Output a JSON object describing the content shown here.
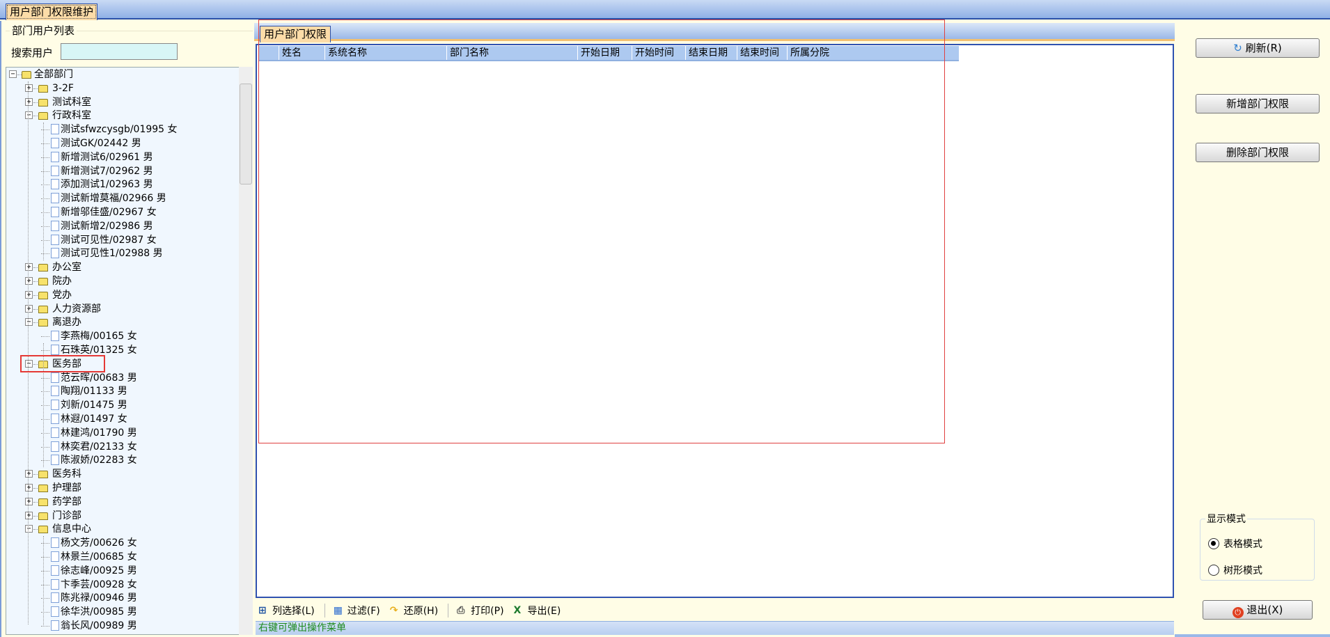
{
  "window_tab": "用户部门权限维护",
  "left_panel": {
    "group_title": "部门用户列表",
    "search_label": "搜索用户",
    "search_value": "",
    "tree": [
      {
        "label": "全部部门",
        "level": 0,
        "type": "folder",
        "expanded": true
      },
      {
        "label": "3-2F",
        "level": 1,
        "type": "folder",
        "expanded": false
      },
      {
        "label": "测试科室",
        "level": 1,
        "type": "folder",
        "expanded": false
      },
      {
        "label": "行政科室",
        "level": 1,
        "type": "folder",
        "expanded": true
      },
      {
        "label": "测试sfwzcysgb/01995 女",
        "level": 2,
        "type": "user"
      },
      {
        "label": "测试GK/02442 男",
        "level": 2,
        "type": "user"
      },
      {
        "label": "新增测试6/02961 男",
        "level": 2,
        "type": "user"
      },
      {
        "label": "新增测试7/02962 男",
        "level": 2,
        "type": "user"
      },
      {
        "label": "添加测试1/02963 男",
        "level": 2,
        "type": "user"
      },
      {
        "label": "测试新增莫福/02966 男",
        "level": 2,
        "type": "user"
      },
      {
        "label": "新增邬佳盛/02967 女",
        "level": 2,
        "type": "user"
      },
      {
        "label": "测试新增2/02986 男",
        "level": 2,
        "type": "user"
      },
      {
        "label": "测试可见性/02987 女",
        "level": 2,
        "type": "user"
      },
      {
        "label": "测试可见性1/02988 男",
        "level": 2,
        "type": "user"
      },
      {
        "label": "办公室",
        "level": 1,
        "type": "folder",
        "expanded": false
      },
      {
        "label": "院办",
        "level": 1,
        "type": "folder",
        "expanded": false
      },
      {
        "label": "党办",
        "level": 1,
        "type": "folder",
        "expanded": false
      },
      {
        "label": "人力资源部",
        "level": 1,
        "type": "folder",
        "expanded": false
      },
      {
        "label": "离退办",
        "level": 1,
        "type": "folder",
        "expanded": true
      },
      {
        "label": "李燕梅/00165 女",
        "level": 2,
        "type": "user"
      },
      {
        "label": "石珠英/01325 女",
        "level": 2,
        "type": "user"
      },
      {
        "label": "医务部",
        "level": 1,
        "type": "folder",
        "expanded": true,
        "selected": true
      },
      {
        "label": "范云晖/00683 男",
        "level": 2,
        "type": "user"
      },
      {
        "label": "陶翔/01133 男",
        "level": 2,
        "type": "user"
      },
      {
        "label": "刘新/01475 男",
        "level": 2,
        "type": "user"
      },
      {
        "label": "林遐/01497 女",
        "level": 2,
        "type": "user"
      },
      {
        "label": "林建鸿/01790 男",
        "level": 2,
        "type": "user"
      },
      {
        "label": "林奕君/02133 女",
        "level": 2,
        "type": "user"
      },
      {
        "label": "陈淑娇/02283 女",
        "level": 2,
        "type": "user"
      },
      {
        "label": "医务科",
        "level": 1,
        "type": "folder",
        "expanded": false
      },
      {
        "label": "护理部",
        "level": 1,
        "type": "folder",
        "expanded": false
      },
      {
        "label": "药学部",
        "level": 1,
        "type": "folder",
        "expanded": false
      },
      {
        "label": "门诊部",
        "level": 1,
        "type": "folder",
        "expanded": false
      },
      {
        "label": "信息中心",
        "level": 1,
        "type": "folder",
        "expanded": true
      },
      {
        "label": "杨文芳/00626 女",
        "level": 2,
        "type": "user"
      },
      {
        "label": "林景兰/00685 女",
        "level": 2,
        "type": "user"
      },
      {
        "label": "徐志峰/00925 男",
        "level": 2,
        "type": "user"
      },
      {
        "label": "卞季芸/00928 女",
        "level": 2,
        "type": "user"
      },
      {
        "label": "陈兆禄/00946 男",
        "level": 2,
        "type": "user"
      },
      {
        "label": "徐华洪/00985 男",
        "level": 2,
        "type": "user"
      },
      {
        "label": "翁长风/00989 男",
        "level": 2,
        "type": "user"
      }
    ]
  },
  "center": {
    "tab": "用户部门权限",
    "columns": [
      "",
      "姓名",
      "系统名称",
      "部门名称",
      "开始日期",
      "开始时间",
      "结束日期",
      "结束时间",
      "所属分院"
    ],
    "rows": [],
    "toolbar": [
      {
        "label": "列选择(L)",
        "icon": "column-select-icon"
      },
      {
        "label": "过滤(F)",
        "icon": "filter-icon"
      },
      {
        "label": "还原(H)",
        "icon": "restore-arrow-icon"
      },
      {
        "label": "打印(P)",
        "icon": "printer-icon"
      },
      {
        "label": "导出(E)",
        "icon": "excel-export-icon"
      }
    ],
    "status": "右键可弹出操作菜单"
  },
  "right_panel": {
    "refresh": "刷新(R)",
    "add": "新增部门权限",
    "delete": "删除部门权限",
    "mode_title": "显示模式",
    "modes": [
      {
        "label": "表格模式",
        "checked": true
      },
      {
        "label": "树形模式",
        "checked": false
      }
    ],
    "exit": "退出(X)"
  },
  "colors": {
    "accent_blue": "#2f52b0",
    "panel_bg": "#fffde6",
    "tab_bg": "#fcdca8",
    "highlight": "#e53935",
    "status_text": "#1d8a1d"
  }
}
